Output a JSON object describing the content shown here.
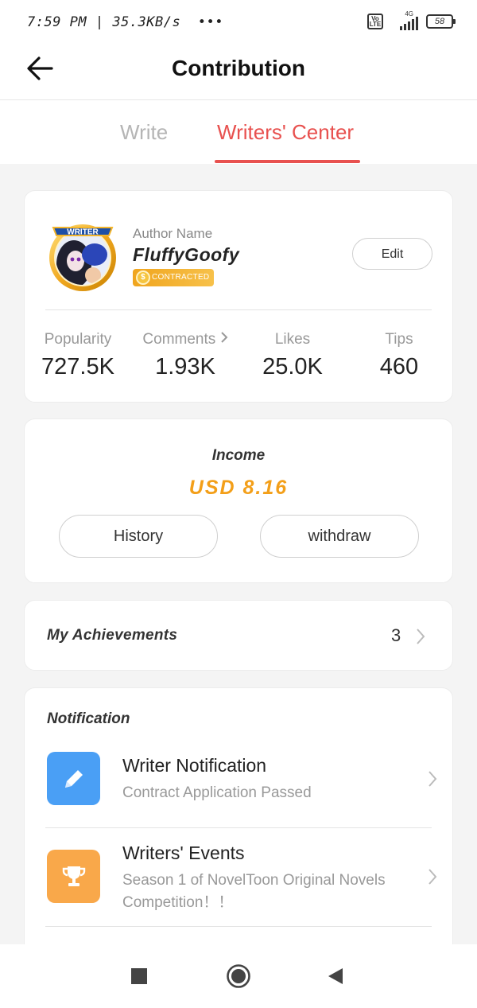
{
  "status_bar": {
    "time": "7:59 PM | 35.3KB/s",
    "dots": "•••",
    "volte": "Vo LTE",
    "network": "4G",
    "battery": "58"
  },
  "header": {
    "title": "Contribution",
    "back_icon": "arrow-left-icon"
  },
  "tabs": {
    "write": "Write",
    "writers_center": "Writers' Center",
    "active": "Writers' Center",
    "active_color": "#e8514f"
  },
  "profile": {
    "avatar_badge": "WRITER",
    "author_label": "Author Name",
    "author_name": "FluffyGoofy",
    "badge": "CONTRACTED",
    "edit_label": "Edit",
    "stats": [
      {
        "label": "Popularity",
        "value": "727.5K"
      },
      {
        "label": "Comments",
        "value": "1.93K"
      },
      {
        "label": "Likes",
        "value": "25.0K"
      },
      {
        "label": "Tips",
        "value": "460"
      }
    ]
  },
  "income": {
    "title": "Income",
    "amount": "USD 8.16",
    "amount_color": "#f39f19",
    "history_label": "History",
    "withdraw_label": "withdraw"
  },
  "achievements": {
    "label": "My Achievements",
    "count": "3"
  },
  "notification": {
    "title": "Notification",
    "items": [
      {
        "name": "Writer Notification",
        "subtitle": "Contract Application Passed",
        "icon": "pencil-icon",
        "icon_color": "#4a9ff5"
      },
      {
        "name": "Writers' Events",
        "subtitle": "Season 1 of NovelToon Original Novels Competition！！",
        "icon": "trophy-icon",
        "icon_color": "#f9a84a"
      }
    ]
  },
  "nav_bar": {
    "icons": [
      "square-icon",
      "circle-home-icon",
      "triangle-back-icon"
    ]
  }
}
